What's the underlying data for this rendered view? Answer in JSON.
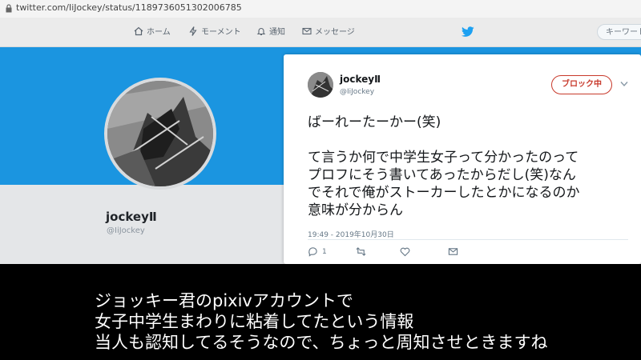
{
  "browser": {
    "url": "twitter.com/IiJockey/status/1189736051302006785"
  },
  "nav": {
    "items": [
      {
        "label": "ホーム",
        "icon": "home-icon"
      },
      {
        "label": "モーメント",
        "icon": "bolt-icon"
      },
      {
        "label": "通知",
        "icon": "bell-icon"
      },
      {
        "label": "メッセージ",
        "icon": "envelope-icon"
      }
    ],
    "search_placeholder": "キーワード"
  },
  "profile": {
    "name": "jockeyⅡ",
    "handle": "@IiJockey"
  },
  "tweet": {
    "name": "jockeyⅡ",
    "handle": "@IiJockey",
    "block_label": "ブロック中",
    "text_lines": [
      "ばーれーたーかー(笑)",
      "",
      "て言うか何で中学生女子って分かったのって",
      "プロフにそう書いてあったからだし(笑)なん",
      "でそれで俺がストーカーしたとかになるのか",
      "意味が分からん"
    ],
    "timestamp": "19:49 - 2019年10月30日",
    "reply_count": "1"
  },
  "subtitle": {
    "lines": [
      "ジョッキー君のpixivアカウントで",
      "女子中学生まわりに粘着してたという情報",
      "当人も認知してるそうなので、ちょっと周知させときますね"
    ]
  },
  "colors": {
    "banner": "#1b95e0",
    "block": "#c8392b",
    "twitter_blue": "#1da1f2"
  }
}
